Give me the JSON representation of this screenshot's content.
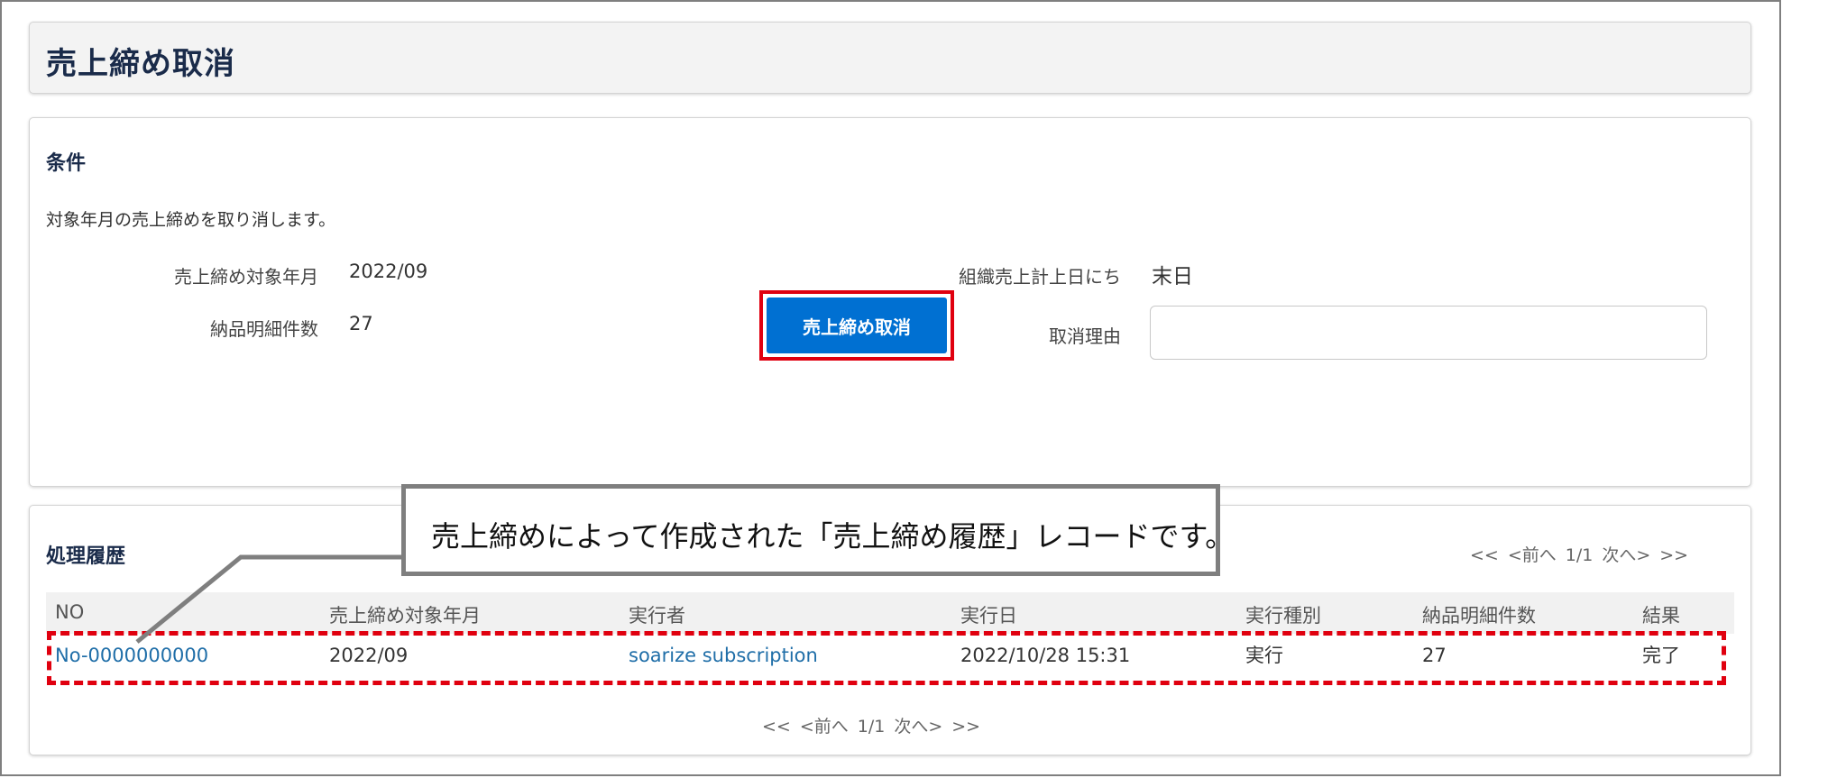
{
  "page": {
    "title": "売上締め取消"
  },
  "conditions": {
    "section_title": "条件",
    "description": "対象年月の売上締めを取り消します。",
    "fields": {
      "target_month_label": "売上締め対象年月",
      "target_month_value": "2022/09",
      "detail_count_label": "納品明細件数",
      "detail_count_value": "27",
      "org_close_day_label": "組織売上計上日にち",
      "org_close_day_value": "末日",
      "cancel_reason_label": "取消理由",
      "cancel_reason_value": ""
    },
    "submit_label": "売上締め取消"
  },
  "history": {
    "section_title": "処理履歴",
    "pager_top": {
      "first": "<<",
      "prev": "<前へ",
      "page": "1/1",
      "next": "次へ>",
      "last": ">>"
    },
    "pager_bottom": {
      "first": "<<",
      "prev": "<前へ",
      "page": "1/1",
      "next": "次へ>",
      "last": ">>"
    },
    "columns": [
      "NO",
      "売上締め対象年月",
      "実行者",
      "実行日",
      "実行種別",
      "納品明細件数",
      "結果"
    ],
    "rows": [
      {
        "no": "No-0000000000",
        "target_month": "2022/09",
        "executor": "soarize subscription",
        "executed_at": "2022/10/28 15:31",
        "exec_type": "実行",
        "detail_count": "27",
        "result": "完了"
      }
    ]
  },
  "callout": {
    "text": "売上締めによって作成された「売上締め履歴」レコードです。"
  },
  "colors": {
    "primary_button": "#0070d2",
    "highlight": "#e0000f",
    "link": "#1f6ea8",
    "heading": "#1a2b4a"
  }
}
